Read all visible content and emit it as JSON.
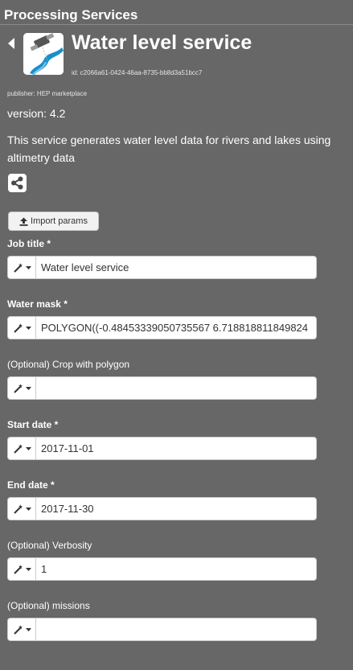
{
  "panel": {
    "title": "Processing Services"
  },
  "service": {
    "name": "Water level service",
    "id_text": "id: c2066a61-0424-46aa-8735-bb8d3a51bcc7",
    "publisher": "publisher: HEP marketplace",
    "version": "version: 4.2",
    "description": "This service generates water level data for rivers and lakes using altimetry data"
  },
  "actions": {
    "import_label": "Import params"
  },
  "icons": {
    "back": "caret-left-icon",
    "share": "share-icon",
    "upload": "upload-icon",
    "tool": "magic-wand-icon",
    "caret": "caret-down-icon"
  },
  "fields": [
    {
      "label": "Job title *",
      "value": "Water level service",
      "placeholder": ""
    },
    {
      "label": "Water mask *",
      "value": "POLYGON((-0.48453339050735567 6.718818811849824",
      "placeholder": ""
    },
    {
      "label": "(Optional) Crop with polygon",
      "value": "",
      "placeholder": ""
    },
    {
      "label": "Start date *",
      "value": "2017-11-01",
      "placeholder": ""
    },
    {
      "label": "End date *",
      "value": "2017-11-30",
      "placeholder": ""
    },
    {
      "label": "(Optional) Verbosity",
      "value": "1",
      "placeholder": ""
    },
    {
      "label": "(Optional) missions",
      "value": "",
      "placeholder": ""
    }
  ],
  "colors": {
    "background": "#676767",
    "text": "#ffffff",
    "input_bg": "#ffffff",
    "input_text": "#333333",
    "logo_water": "#1a8fc8"
  }
}
